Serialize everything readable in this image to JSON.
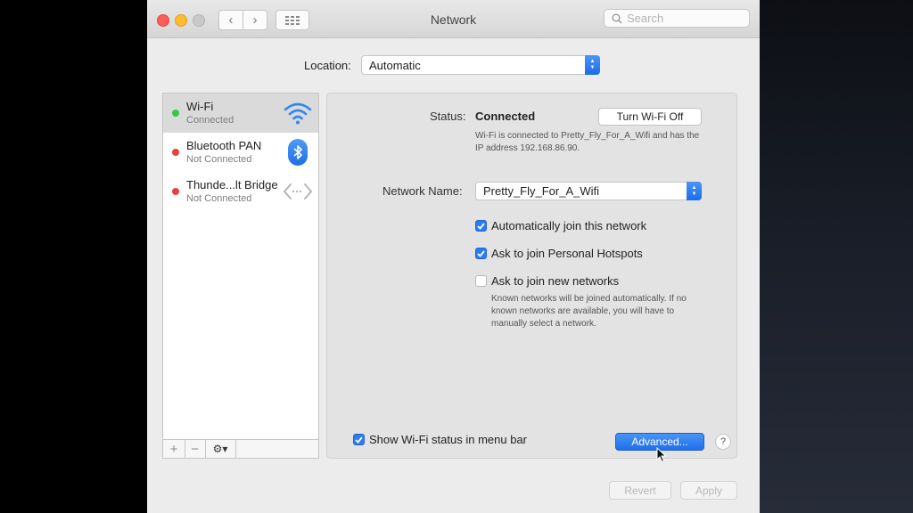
{
  "window": {
    "title": "Network",
    "search_placeholder": "Search"
  },
  "location": {
    "label": "Location:",
    "value": "Automatic"
  },
  "services": [
    {
      "name": "Wi-Fi",
      "status": "Connected",
      "dot_color": "#34c84a",
      "icon": "wifi-icon"
    },
    {
      "name": "Bluetooth PAN",
      "status": "Not Connected",
      "dot_color": "#e8403b",
      "icon": "bluetooth-icon"
    },
    {
      "name": "Thunde...lt Bridge",
      "status": "Not Connected",
      "dot_color": "#e8403b",
      "icon": "thunderbolt-bridge-icon"
    }
  ],
  "sidebar_tools": {
    "add": "+",
    "remove": "−",
    "gear": "⚙▾"
  },
  "detail": {
    "status_label": "Status:",
    "status_value": "Connected",
    "turn_off_label": "Turn Wi-Fi Off",
    "status_description": "Wi-Fi is connected to Pretty_Fly_For_A_Wifi and has the IP address 192.168.86.90.",
    "network_name_label": "Network Name:",
    "network_name_value": "Pretty_Fly_For_A_Wifi",
    "options": [
      {
        "label": "Automatically join this network",
        "checked": true
      },
      {
        "label": "Ask to join Personal Hotspots",
        "checked": true
      },
      {
        "label": "Ask to join new networks",
        "checked": false
      }
    ],
    "hint": "Known networks will be joined automatically. If no known networks are available, you will have to manually select a network.",
    "show_status_label": "Show Wi-Fi status in menu bar",
    "show_status_checked": true,
    "advanced_label": "Advanced...",
    "help_label": "?"
  },
  "footer": {
    "revert_label": "Revert",
    "apply_label": "Apply"
  },
  "colors": {
    "accent": "#2b7cf0",
    "connected": "#34c84a",
    "not_connected": "#e8403b"
  }
}
